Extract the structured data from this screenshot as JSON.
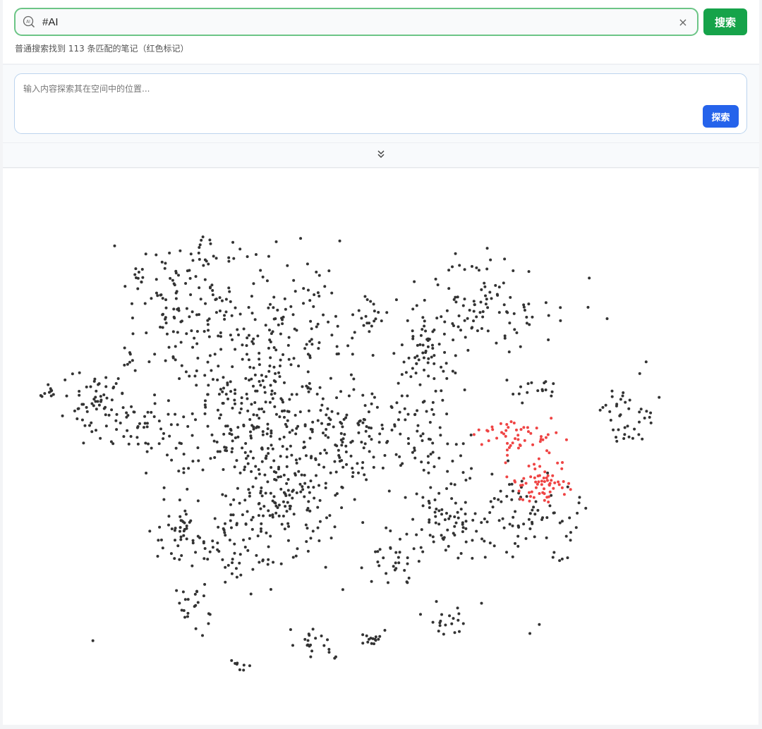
{
  "search": {
    "value": "#AI",
    "icon": "ai-search-icon",
    "clear_icon": "×",
    "button_label": "搜索"
  },
  "status": {
    "text": "普通搜索找到 113 条匹配的笔记（红色标记）",
    "match_count": 113
  },
  "explore": {
    "placeholder": "输入内容探索其在空间中的位置...",
    "button_label": "探索"
  },
  "toggle": {
    "icon": "double-chevron-down-icon"
  },
  "plot": {
    "point_color": "#333333",
    "highlight_color": "#ef4444",
    "highlighted_points": 113
  }
}
